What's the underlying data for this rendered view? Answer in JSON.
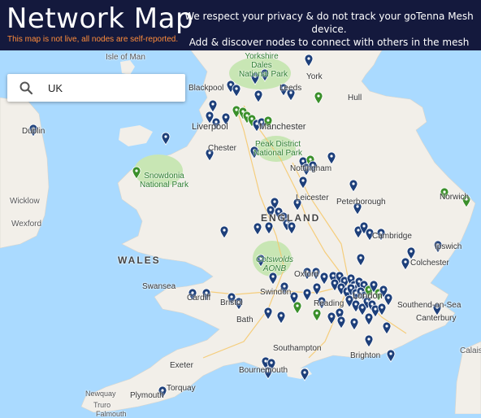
{
  "header": {
    "title": "Network Map",
    "subtitle": "This map is not live, all nodes are self-reported.",
    "privacy_line1": "We respect your privacy & do not track your goTenna Mesh device.",
    "privacy_line2": "Add & discover nodes to connect with others in the mesh network!"
  },
  "search": {
    "value": "UK",
    "icon": "search-icon"
  },
  "map": {
    "place_labels": {
      "isle_of_man": "Isle of Man",
      "yorkshire_dales": "Yorkshire Dales National Park",
      "yorkshire_1": "Yorkshire",
      "yorkshire_2": "Dales",
      "yorkshire_3": "National Park",
      "york": "York",
      "blackpool": "Blackpool",
      "leeds": "Leeds",
      "hull": "Hull",
      "dublin": "Dublin",
      "liverpool": "Liverpool",
      "manchester": "Manchester",
      "chester": "Chester",
      "peak_1": "Peak District",
      "peak_2": "National Park",
      "snowdonia_1": "Snowdonia",
      "snowdonia_2": "National Park",
      "nottingham": "Nottingham",
      "norwich": "Norwich",
      "wicklow": "Wicklow",
      "wexford": "Wexford",
      "leicester": "Leicester",
      "peterborough": "Peterborough",
      "england": "ENGLAND",
      "cambridge": "Cambridge",
      "ipswich": "Ipswich",
      "wales": "WALES",
      "colchester": "Colchester",
      "oxford": "Oxford",
      "cotswolds_1": "Cotswolds",
      "cotswolds_2": "AONB",
      "swansea": "Swansea",
      "cardiff": "Cardiff",
      "bristol": "Bristol",
      "swindon": "Swindon",
      "london": "London",
      "reading": "Reading",
      "southend": "Southend-on-Sea",
      "bath": "Bath",
      "canterbury": "Canterbury",
      "southampton": "Southampton",
      "brighton": "Brighton",
      "calais": "Calais",
      "exeter": "Exeter",
      "bournemouth": "Bournemouth",
      "torquay": "Torquay",
      "plymouth": "Plymouth",
      "newquay": "Newquay",
      "truro": "Truro",
      "falmouth": "Falmouth"
    }
  },
  "colors": {
    "header_bg": "#14193d",
    "subtitle": "#ff8c3a",
    "water": "#aadaff",
    "land": "#f2efe9",
    "park": "#c8e6b4",
    "node_blue": "#1d3f7a",
    "node_green": "#3a8f2a"
  }
}
